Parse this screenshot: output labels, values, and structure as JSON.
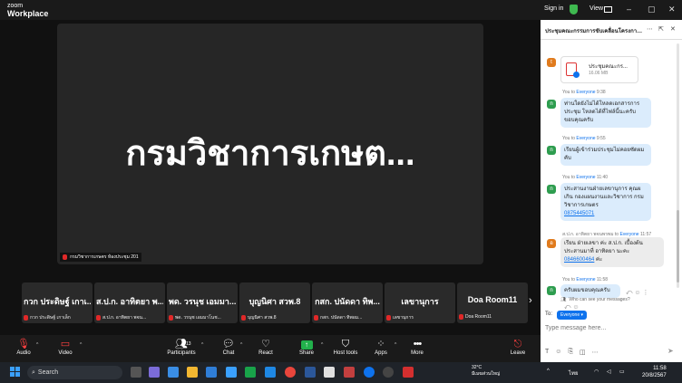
{
  "app": {
    "logo_line1": "zoom",
    "logo_line2": "Workplace",
    "sign_in": "Sign in",
    "view": "View"
  },
  "window_controls": [
    "–",
    "▢",
    "✕"
  ],
  "main_tile": {
    "display_name": "กรมวิชาการเกษต...",
    "caption": "กรมวิชาการเกษตร ห้องประชุม 201"
  },
  "participants": [
    {
      "big": "กวก ประดิษฐ์ เกาเ...",
      "small": "กวก ประดิษฐ์ เกาเล็ก"
    },
    {
      "big": "ส.ป.ก. อาทิตยา พ...",
      "small": "ส.ป.ก. อาทิตยา พจน..."
    },
    {
      "big": "พด. วรนุช เอมมา...",
      "small": "พด. วรนุช เอมมาโนช..."
    },
    {
      "big": "บุญนิศา สวพ.8",
      "small": "บุญนิศา สวพ.8"
    },
    {
      "big": "กสก. ปนัดดา ทิพ...",
      "small": "กสก. ปนัดดา ทิพอม..."
    },
    {
      "big": "เลขานุการ",
      "small": "เลขานุการ"
    },
    {
      "big": "Doa Room11",
      "small": "Doa Room11"
    }
  ],
  "toolbar": {
    "audio": "Audio",
    "video": "Video",
    "participants": "Participants",
    "participants_count": "13",
    "chat": "Chat",
    "react": "React",
    "share": "Share",
    "host_tools": "Host tools",
    "apps": "Apps",
    "more": "More",
    "leave": "Leave"
  },
  "chat": {
    "title": "ประชุมคณะกรรมการขับเคลื่อนโครงการ...",
    "file": {
      "name": "ประชุมคณะกร...",
      "size": "16.06 MB"
    },
    "top_avatar": "t",
    "messages": [
      {
        "avatar": "n",
        "from": "You to",
        "to": "Everyone",
        "time": "9:38",
        "text": "ท่านใดยังไม่ได้โหลดเอกสารการประชุม โหลดได้ที่ไฟล์นี้นะครับ ขอบคุณครับ"
      },
      {
        "avatar": "n",
        "from": "You to",
        "to": "Everyone",
        "time": "9:55",
        "text": "เรียนผู้เข้าร่วมประชุมไม่คอยซัดผมคับ"
      },
      {
        "avatar": "n",
        "from": "You to",
        "to": "Everyone",
        "time": "11:40",
        "text": "ประสานงานฝ่ายเลขานุการ คุณผเกิน กองแผนงานและวิชาการ กรมวิชาการเกษตร",
        "link": "0875445071"
      },
      {
        "avatar": "อ",
        "from": "ส.ป.ก. อาทิตยา พจนพรพม to",
        "to": "Everyone",
        "time": "11:57",
        "text": "เรียน ฝ่ายเลขา ค่ะ ส.ป.ก. เบื้องต้นประสานมาที่ อาทิตยา นะคะ",
        "link": "0846600464",
        "after": " ค่ะ"
      },
      {
        "avatar": "n",
        "from": "You to",
        "to": "Everyone",
        "time": "11:58",
        "text": "ครับผมขอบคุณครับ"
      }
    ],
    "who_can_see": "Who can see your messages?",
    "to_label": "To:",
    "to_value": "Everyone",
    "placeholder": "Type message here..."
  },
  "taskbar": {
    "search": "Search",
    "weather_temp": "32°C",
    "weather_desc": "มีเมฆส่วนใหญ่",
    "lang": "ไทย",
    "time": "11:58",
    "date": "20/8/2567"
  },
  "colors": {
    "accent": "#0e72ed",
    "bubble": "#dbecfc",
    "leave": "#e02828",
    "share": "#22b14c"
  }
}
